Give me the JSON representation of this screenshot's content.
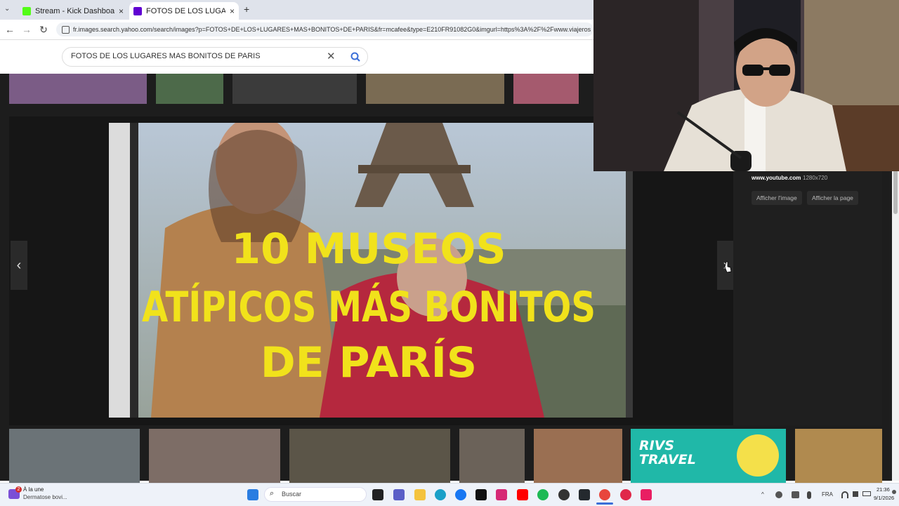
{
  "browser": {
    "tabs": [
      {
        "label": "Stream - Kick Dashboard",
        "active": false,
        "favicon_color": "#53fc18"
      },
      {
        "label": "FOTOS DE LOS LUGARES MAS B",
        "active": true,
        "favicon_color": "#6001d2"
      }
    ],
    "new_tab_symbol": "+",
    "close_symbol": "×",
    "url": "fr.images.search.yahoo.com/search/images?p=FOTOS+DE+LOS+LUGARES+MAS+BONITOS+DE+PARIS&fr=mcafee&type=E210FR91082G0&imgurl=https%3A%2F%2Fwww.viajeros"
  },
  "search": {
    "query": "FOTOS DE LOS LUGARES MAS BONITOS DE PARIS",
    "clear_icon": "close-icon",
    "submit_icon": "search-icon",
    "accent": "#3b6fd8"
  },
  "viewer": {
    "headline_lines": [
      "10 MUSEOS",
      "ATÍPICOS MÁS BONITOS",
      "DE PARÍS"
    ],
    "headline_color": "#f1e21b",
    "source_domain": "www.youtube.com",
    "source_dims": "1280x720",
    "view_image_label": "Afficher l'image",
    "view_page_label": "Afficher la page",
    "prev_icon": "‹",
    "next_icon": "›"
  },
  "bottom_thumbs": [
    {
      "name": "paris-boulevard",
      "color": "#6b7377"
    },
    {
      "name": "gargoyle-sunset",
      "color": "#7d6d66"
    },
    {
      "name": "castle",
      "color": "#5b5548"
    },
    {
      "name": "boulangerie",
      "color": "#6b6259"
    },
    {
      "name": "aqueduct",
      "color": "#9a6f52"
    },
    {
      "name": "rivs-travel",
      "color": "#20b8a8",
      "text": "RIVS TRAVEL"
    },
    {
      "name": "colmar-houses",
      "color": "#b08a4f"
    }
  ],
  "top_thumbs": [
    {
      "name": "lavender",
      "color": "#7b5c86"
    },
    {
      "name": "park-aerial",
      "color": "#4d6a4a"
    },
    {
      "name": "eiffel-bw",
      "color": "#3b3b3b"
    },
    {
      "name": "city-aerial",
      "color": "#7a6b53"
    },
    {
      "name": "bridge-pink",
      "color": "#a55a6e"
    }
  ],
  "taskbar": {
    "search_placeholder": "Buscar",
    "notification_title": "À la une",
    "notification_text": "Dermatose bovi...",
    "notification_badge": "2",
    "lang": "FRA",
    "time": "21:36",
    "date": "9/1/2026",
    "apps": [
      {
        "icon": "windows-icon",
        "color": "#2a7de1"
      },
      {
        "icon": "task-view-icon",
        "color": "#222222"
      },
      {
        "icon": "teams-icon",
        "color": "#5b5fc7"
      },
      {
        "icon": "folder-icon",
        "color": "#f4c33d"
      },
      {
        "icon": "edge-icon",
        "color": "#1aa0c8"
      },
      {
        "icon": "facebook-icon",
        "color": "#1877f2"
      },
      {
        "icon": "tiktok-icon",
        "color": "#111111"
      },
      {
        "icon": "instagram-icon",
        "color": "#d62976"
      },
      {
        "icon": "youtube-icon",
        "color": "#ff0000"
      },
      {
        "icon": "spotify-icon",
        "color": "#1db954"
      },
      {
        "icon": "obs-icon",
        "color": "#333333"
      },
      {
        "icon": "github-icon",
        "color": "#24292e"
      },
      {
        "icon": "chrome-icon",
        "color": "#e8453c"
      },
      {
        "icon": "app-red-icon",
        "color": "#e0284a"
      },
      {
        "icon": "tiktok-studio-icon",
        "color": "#e91e63"
      }
    ]
  }
}
